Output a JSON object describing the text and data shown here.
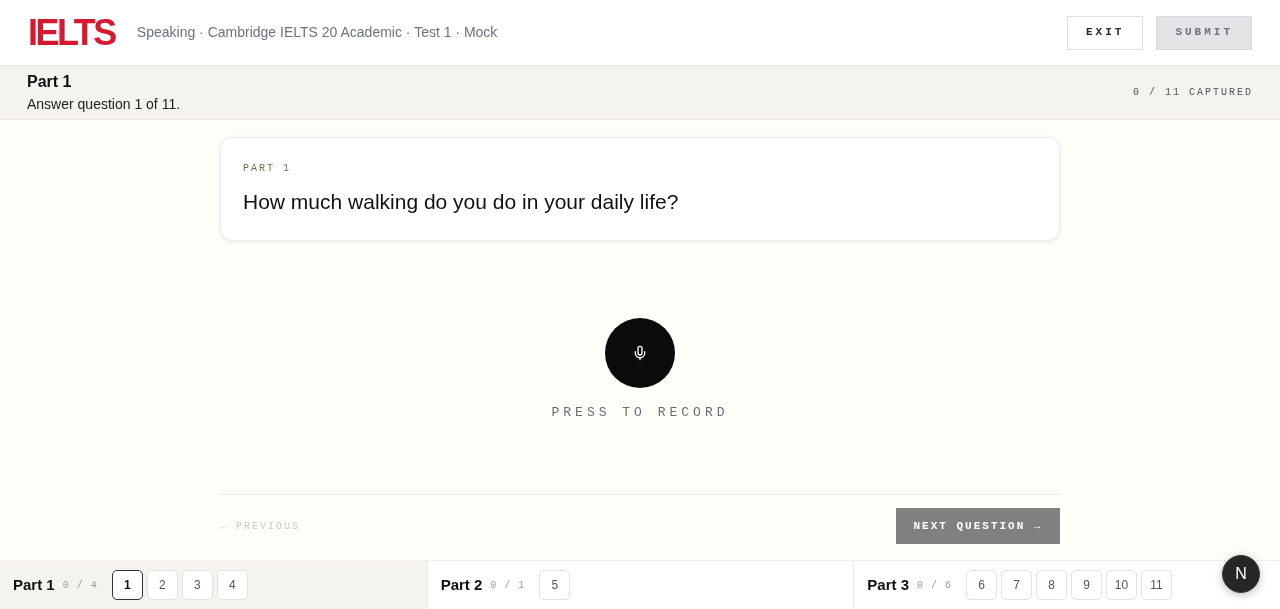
{
  "header": {
    "logo": "IELTS",
    "breadcrumb": "Speaking · Cambridge IELTS 20 Academic · Test 1 · Mock",
    "buttons": [
      {
        "label": "EXIT",
        "kind": "outline",
        "disabled": false
      },
      {
        "label": "SUBMIT",
        "kind": "filled",
        "disabled": true
      }
    ]
  },
  "part_bar": {
    "title": "Part 1",
    "subtitle": "Answer question 1 of 11.",
    "progress": "0 / 11 CAPTURED"
  },
  "question_card": {
    "eyebrow": "PART 1",
    "question": "How much walking do you do in your daily life?"
  },
  "recorder": {
    "label": "PRESS TO RECORD",
    "recording": false
  },
  "navigation": {
    "previous": {
      "label": "← PREVIOUS",
      "disabled": true
    },
    "next": {
      "label": "NEXT QUESTION →",
      "disabled": true
    }
  },
  "parts": [
    {
      "title": "Part 1",
      "count": "0 / 4",
      "selected": true,
      "questions": [
        {
          "label": "1",
          "selected": true
        },
        {
          "label": "2",
          "selected": false
        },
        {
          "label": "3",
          "selected": false
        },
        {
          "label": "4",
          "selected": false
        }
      ]
    },
    {
      "title": "Part 2",
      "count": "0 / 1",
      "selected": false,
      "questions": [
        {
          "label": "5",
          "selected": false
        }
      ]
    },
    {
      "title": "Part 3",
      "count": "0 / 6",
      "selected": false,
      "questions": [
        {
          "label": "6",
          "selected": false
        },
        {
          "label": "7",
          "selected": false
        },
        {
          "label": "8",
          "selected": false
        },
        {
          "label": "9",
          "selected": false
        },
        {
          "label": "10",
          "selected": false
        },
        {
          "label": "11",
          "selected": false
        }
      ]
    }
  ],
  "dev_badge": {
    "label": "N"
  }
}
